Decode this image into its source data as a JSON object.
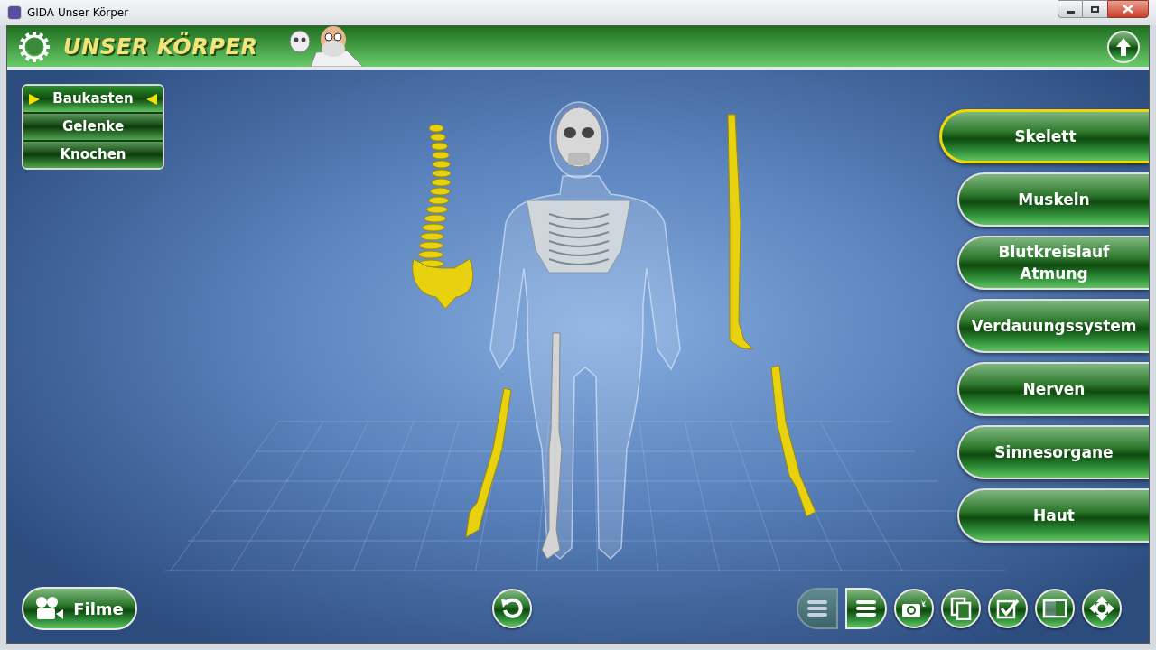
{
  "window": {
    "title": "GIDA Unser Körper"
  },
  "header": {
    "title": "UNSER KÖRPER"
  },
  "left_menu": [
    {
      "label": "Baukasten",
      "selected": true
    },
    {
      "label": "Gelenke",
      "selected": false
    },
    {
      "label": "Knochen",
      "selected": false
    }
  ],
  "right_nav": [
    {
      "label": "Skelett",
      "selected": true
    },
    {
      "label": "Muskeln",
      "selected": false
    },
    {
      "label": "Blutkreislauf\nAtmung",
      "selected": false
    },
    {
      "label": "Verdauungssystem",
      "selected": false
    },
    {
      "label": "Nerven",
      "selected": false
    },
    {
      "label": "Sinnesorgane",
      "selected": false
    },
    {
      "label": "Haut",
      "selected": false
    }
  ],
  "films_button": {
    "label": "Filme"
  },
  "view_toggle": [
    {
      "selected": false
    },
    {
      "selected": true
    }
  ]
}
